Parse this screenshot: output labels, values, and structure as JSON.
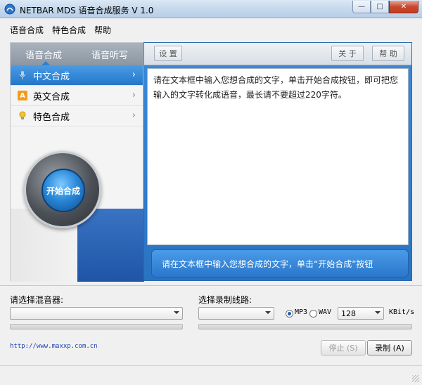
{
  "window": {
    "title": "NETBAR MDS 语音合成服务 V 1.0",
    "controls": {
      "minimize": "—",
      "maximize": "□",
      "close": "✕"
    }
  },
  "menubar": [
    "语音合成",
    "特色合成",
    "帮助"
  ],
  "left_panel": {
    "tabs": [
      "语音合成",
      "语音听写"
    ],
    "active_tab": 0,
    "items": [
      {
        "label": "中文合成",
        "icon": "microphone-icon",
        "active": true
      },
      {
        "label": "英文合成",
        "icon": "letter-a-icon",
        "active": false
      },
      {
        "label": "特色合成",
        "icon": "lightbulb-icon",
        "active": false
      }
    ],
    "start_button": "开始合成"
  },
  "toolbar": {
    "settings": "设 置",
    "about": "关 于",
    "help": "帮 助"
  },
  "text_area": "请在文本框中输入您想合成的文字，单击开始合成按钮，即可把您输入的文字转化成语音，最长请不要超过220字符。",
  "hint_bar": "请在文本框中输入您想合成的文字，单击“开始合成”按钮",
  "bottom": {
    "mixer_label": "请选择混音器:",
    "mixer_value": "",
    "line_label": "选择录制线路:",
    "line_value": "",
    "format_options": [
      "MP3",
      "WAV"
    ],
    "format_selected": "MP3",
    "bitrate_value": "128",
    "bitrate_unit": "KBit/s",
    "url": "http://www.maxxp.com.cn",
    "stop_button": "停止 (S)",
    "record_button": "录制 (A)"
  },
  "colors": {
    "accent": "#2a77cc",
    "close": "#c8492e",
    "link": "#1a3fb0"
  }
}
